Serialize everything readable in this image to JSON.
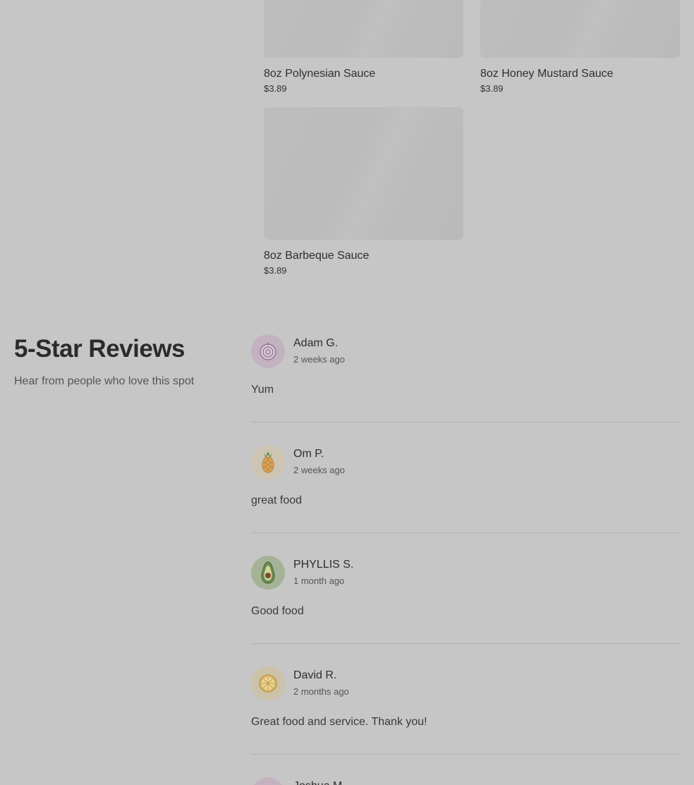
{
  "products": [
    {
      "name": "8oz Polynesian Sauce",
      "price": "$3.89"
    },
    {
      "name": "8oz Honey Mustard Sauce",
      "price": "$3.89"
    },
    {
      "name": "8oz Barbeque Sauce",
      "price": "$3.89"
    }
  ],
  "reviews_section": {
    "title": "5-Star Reviews",
    "subtitle": "Hear from people who love this spot",
    "items": [
      {
        "name": "Adam G.",
        "time": "2 weeks ago",
        "text": "Yum",
        "avatar_icon": "onion-icon",
        "avatar_color": "#c3b3c0"
      },
      {
        "name": "Om P.",
        "time": "2 weeks ago",
        "text": "great food",
        "avatar_icon": "pineapple-icon",
        "avatar_color": "#cdc4b1"
      },
      {
        "name": "PHYLLIS S.",
        "time": "1 month ago",
        "text": "Good food",
        "avatar_icon": "avocado-icon",
        "avatar_color": "#a4b395"
      },
      {
        "name": "David R.",
        "time": "2 months ago",
        "text": "Great food and service. Thank you!",
        "avatar_icon": "lemon-icon",
        "avatar_color": "#cbc2a8"
      },
      {
        "name": "Joshua M.",
        "time": "",
        "text": "",
        "avatar_icon": "onion-icon",
        "avatar_color": "#c3b3c0"
      }
    ]
  }
}
